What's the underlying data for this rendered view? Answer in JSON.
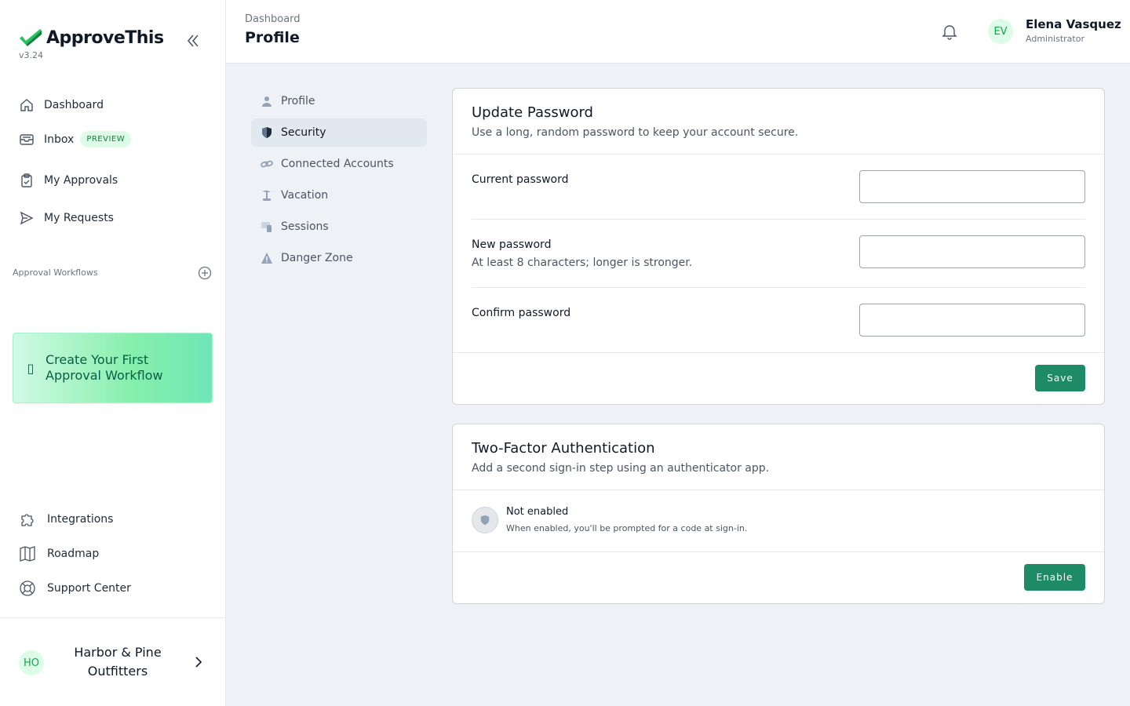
{
  "brand": {
    "name": "ApproveThis",
    "version": "v3.24"
  },
  "sidebar": {
    "items": [
      {
        "label": "Dashboard",
        "icon": "home-icon"
      },
      {
        "label": "Inbox",
        "icon": "inbox-icon",
        "badge": "PREVIEW"
      },
      {
        "label": "My Approvals",
        "icon": "clipboard-check-icon"
      },
      {
        "label": "My Requests",
        "icon": "send-icon"
      }
    ],
    "section_label": "Approval Workflows",
    "cta": {
      "label": "Create Your First Approval Workflow",
      "icon": "placeholder-glyph"
    },
    "bottom_items": [
      {
        "label": "Integrations",
        "icon": "puzzle-icon"
      },
      {
        "label": "Roadmap",
        "icon": "map-icon"
      },
      {
        "label": "Support Center",
        "icon": "lifebuoy-icon"
      }
    ],
    "org": {
      "initials": "HO",
      "name": "Harbor & Pine Outfitters"
    }
  },
  "header": {
    "breadcrumb": "Dashboard",
    "title": "Profile",
    "user": {
      "initials": "EV",
      "name": "Elena Vasquez",
      "role": "Administrator"
    }
  },
  "subnav": {
    "items": [
      {
        "label": "Profile",
        "icon": "user-icon"
      },
      {
        "label": "Security",
        "icon": "shield-icon",
        "active": true
      },
      {
        "label": "Connected Accounts",
        "icon": "link-icon"
      },
      {
        "label": "Vacation",
        "icon": "palm-tree-icon"
      },
      {
        "label": "Sessions",
        "icon": "devices-icon"
      },
      {
        "label": "Danger Zone",
        "icon": "warning-icon"
      }
    ]
  },
  "password_card": {
    "title": "Update Password",
    "subtitle": "Use a long, random password to keep your account secure.",
    "fields": [
      {
        "label": "Current password",
        "hint": "",
        "value": ""
      },
      {
        "label": "New password",
        "hint": "At least 8 characters; longer is stronger.",
        "value": ""
      },
      {
        "label": "Confirm password",
        "hint": "",
        "value": ""
      }
    ],
    "save_label": "Save"
  },
  "twofa_card": {
    "title": "Two-Factor Authentication",
    "subtitle": "Add a second sign-in step using an authenticator app.",
    "status_title": "Not enabled",
    "status_desc": "When enabled, you'll be prompted for a code at sign-in.",
    "enable_label": "Enable"
  },
  "colors": {
    "accent": "#1e8a66",
    "badge_bg": "#dcfce7",
    "active_nav_bg": "#e2e8f0"
  }
}
